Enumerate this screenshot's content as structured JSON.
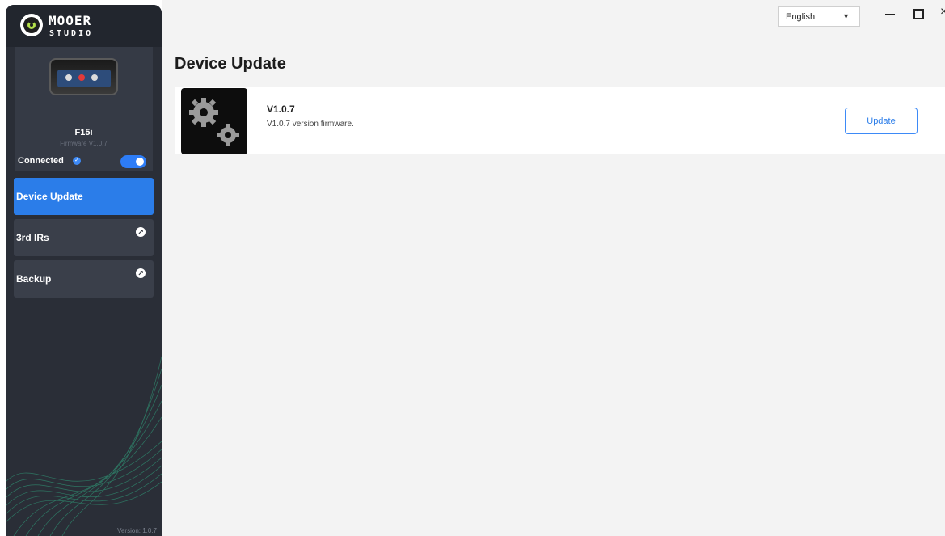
{
  "brand": {
    "line1": "MOOER",
    "line2": "STUDIO"
  },
  "device": {
    "name": "F15i",
    "firmware": "Firmware V1.0.7",
    "status": "Connected",
    "toggle_on": true
  },
  "nav": {
    "items": [
      {
        "label": "Device Update",
        "active": true,
        "external": false
      },
      {
        "label": "3rd IRs",
        "active": false,
        "external": true
      },
      {
        "label": "Backup",
        "active": false,
        "external": true
      }
    ]
  },
  "app_version": "Version: 1.0.7",
  "header": {
    "language": "English"
  },
  "page": {
    "title": "Device Update",
    "update": {
      "version": "V1.0.7",
      "description": "V1.0.7 version firmware.",
      "button_label": "Update"
    }
  },
  "colors": {
    "accent": "#2b7de9",
    "sidebar": "#2a2e37",
    "brand_green": "#b4e04a"
  },
  "icons": {
    "gear": "gear-icon",
    "arrow": "arrow-up-right-icon",
    "check": "check-circle-icon"
  }
}
